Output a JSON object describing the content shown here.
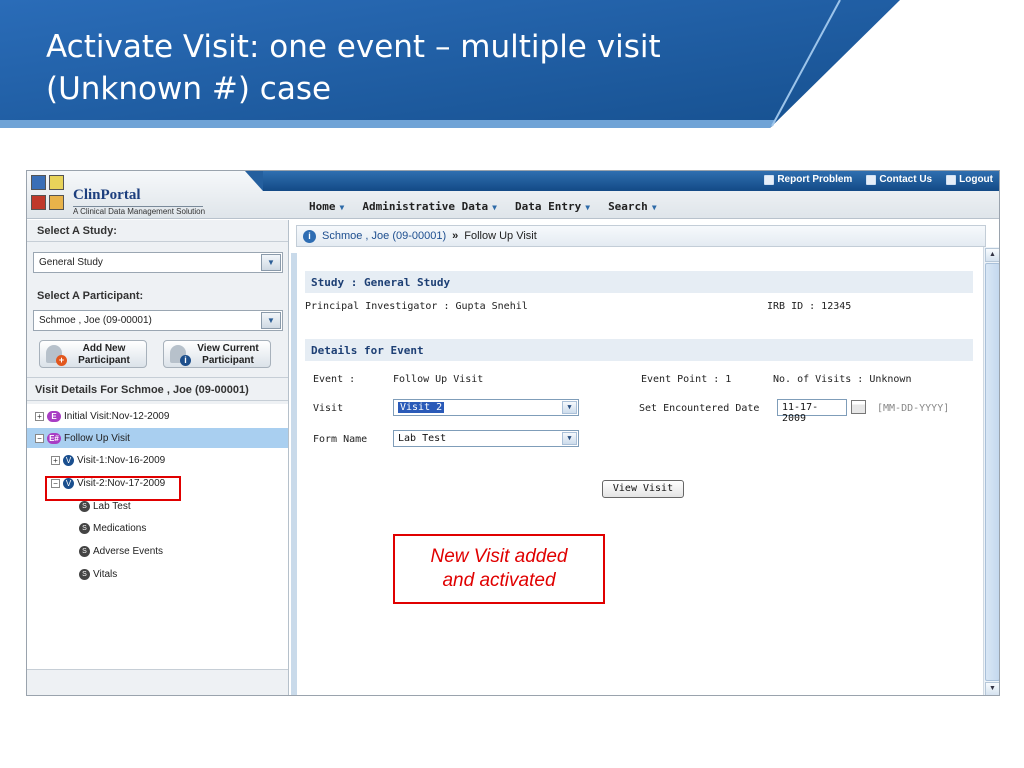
{
  "slide": {
    "title_line1": "Activate Visit: one event – multiple visit",
    "title_line2": "(Unknown #) case"
  },
  "app": {
    "logo_title": "ClinPortal",
    "logo_subtitle": "A Clinical Data Management Solution",
    "top_links": {
      "report_problem": "Report Problem",
      "contact_us": "Contact Us",
      "logout": "Logout"
    },
    "nav": {
      "home": "Home",
      "administrative_data": "Administrative Data",
      "data_entry": "Data Entry",
      "search": "Search"
    }
  },
  "left_panel": {
    "study_label": "Select A Study:",
    "study_value": "General Study",
    "participant_label": "Select A Participant:",
    "participant_value": "Schmoe , Joe (09-00001)",
    "add_participant_line1": "Add New",
    "add_participant_line2": "Participant",
    "view_participant_line1": "View Current",
    "view_participant_line2": "Participant",
    "visit_details_header": "Visit Details For  Schmoe , Joe (09-00001)",
    "tree": [
      {
        "label": "Initial Visit:Nov-12-2009",
        "badge": "E"
      },
      {
        "label": "Follow Up Visit",
        "badge": "E#"
      },
      {
        "label": "Visit-1:Nov-16-2009",
        "badge": "V"
      },
      {
        "label": "Visit-2:Nov-17-2009",
        "badge": "V"
      },
      {
        "label": "Lab Test",
        "badge": "S"
      },
      {
        "label": "Medications",
        "badge": "S"
      },
      {
        "label": "Adverse Events",
        "badge": "S"
      },
      {
        "label": "Vitals",
        "badge": "S"
      }
    ]
  },
  "breadcrumb": {
    "participant": "Schmoe , Joe (09-00001)",
    "separator": "»",
    "current": "Follow Up Visit"
  },
  "study_section": {
    "header": "Study : General Study",
    "pi": "Principal Investigator : Gupta Snehil",
    "irb": "IRB ID : 12345"
  },
  "event_section": {
    "header": "Details for Event",
    "event_label": "Event :",
    "event_value": "Follow Up Visit",
    "event_point": "Event Point : 1",
    "num_visits": "No. of Visits : Unknown",
    "visit_label": "Visit",
    "visit_value": "Visit 2",
    "encounter_label": "Set Encountered Date",
    "encounter_value": "11-17-2009",
    "date_format": "[MM-DD-YYYY]",
    "form_label": "Form Name",
    "form_value": "Lab Test",
    "view_button": "View Visit"
  },
  "callout": {
    "line1": "New Visit  added",
    "line2": "and activated"
  },
  "colors": {
    "banner_blue": "#1f5fa8",
    "highlight_red": "#e00000",
    "tree_selected": "#a9cff0"
  },
  "icons": {
    "report": "document-icon",
    "contact": "mail-icon",
    "logout": "door-icon",
    "info": "info-icon",
    "calendar": "calendar-icon"
  }
}
